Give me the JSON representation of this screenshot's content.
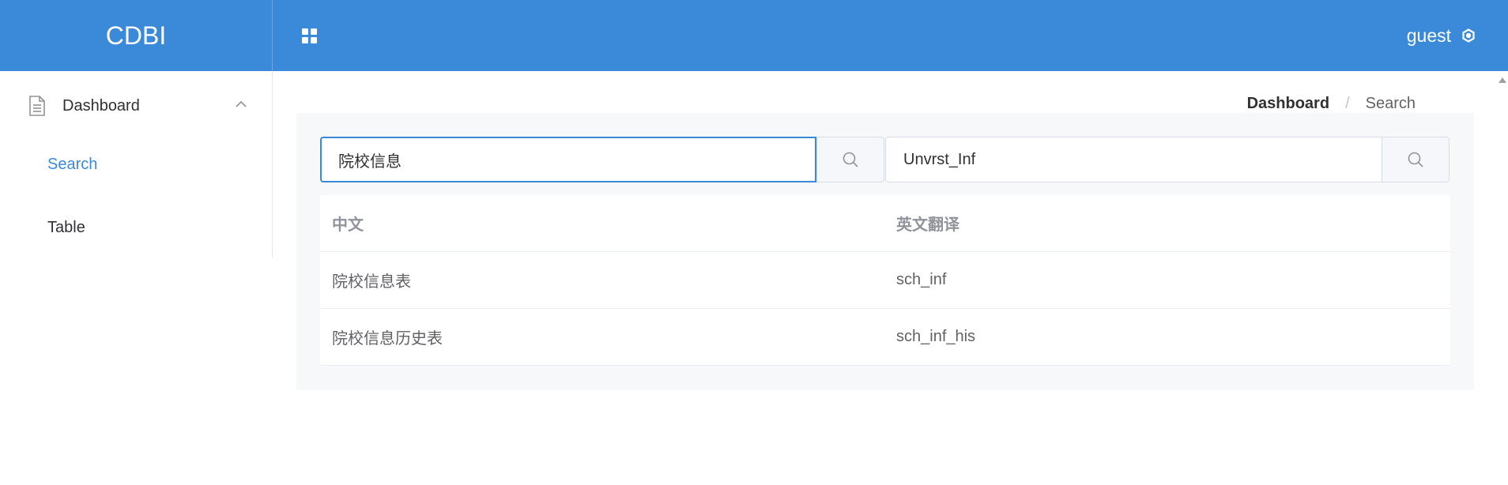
{
  "header": {
    "brand": "CDBI",
    "menu_toggle_icon": "grid-icon",
    "username": "guest",
    "user_icon": "gear-icon",
    "bg_color": "#3b89d9"
  },
  "sidebar": {
    "group": {
      "label": "Dashboard",
      "icon": "document-icon",
      "expanded": true
    },
    "items": [
      {
        "label": "Search",
        "active": true
      },
      {
        "label": "Table",
        "active": false
      }
    ],
    "active_color": "#3b89d9"
  },
  "breadcrumb": {
    "items": [
      "Dashboard",
      "Search"
    ],
    "separator": "/"
  },
  "search": {
    "chinese": {
      "value": "院校信息",
      "button_icon": "search-icon"
    },
    "english": {
      "value": "Unvrst_Inf",
      "button_icon": "search-icon"
    }
  },
  "table": {
    "columns": [
      "中文",
      "英文翻译"
    ],
    "rows": [
      [
        "院校信息表",
        "sch_inf"
      ],
      [
        "院校信息历史表",
        "sch_inf_his"
      ]
    ]
  }
}
